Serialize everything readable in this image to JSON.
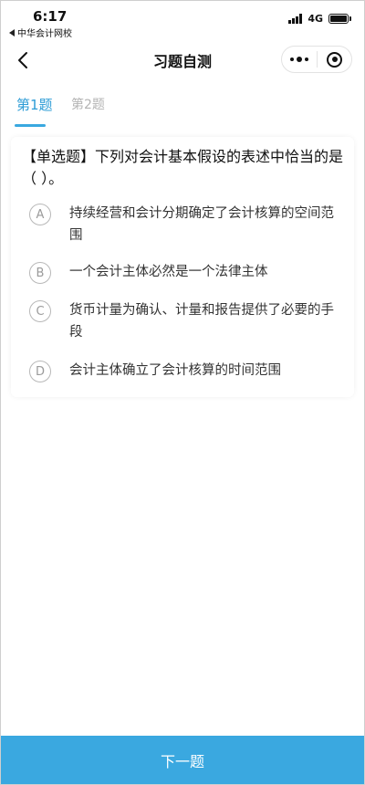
{
  "status_bar": {
    "time": "6:17",
    "back_app": "中华会计网校",
    "network": "4G"
  },
  "nav": {
    "title": "习题自测"
  },
  "tabs": [
    {
      "label": "第1题",
      "active": true
    },
    {
      "label": "第2题",
      "active": false
    }
  ],
  "question": {
    "text": "【单选题】下列对会计基本假设的表述中恰当的是（    ）。",
    "options": [
      {
        "letter": "A",
        "text": "持续经营和会计分期确定了会计核算的空间范围"
      },
      {
        "letter": "B",
        "text": "一个会计主体必然是一个法律主体"
      },
      {
        "letter": "C",
        "text": "货币计量为确认、计量和报告提供了必要的手段"
      },
      {
        "letter": "D",
        "text": "会计主体确立了会计核算的时间范围"
      }
    ]
  },
  "footer": {
    "next_label": "下一题"
  },
  "colors": {
    "accent": "#3aa8e0",
    "tab_active": "#2d9cd6",
    "tab_inactive": "#b4b4b4"
  }
}
